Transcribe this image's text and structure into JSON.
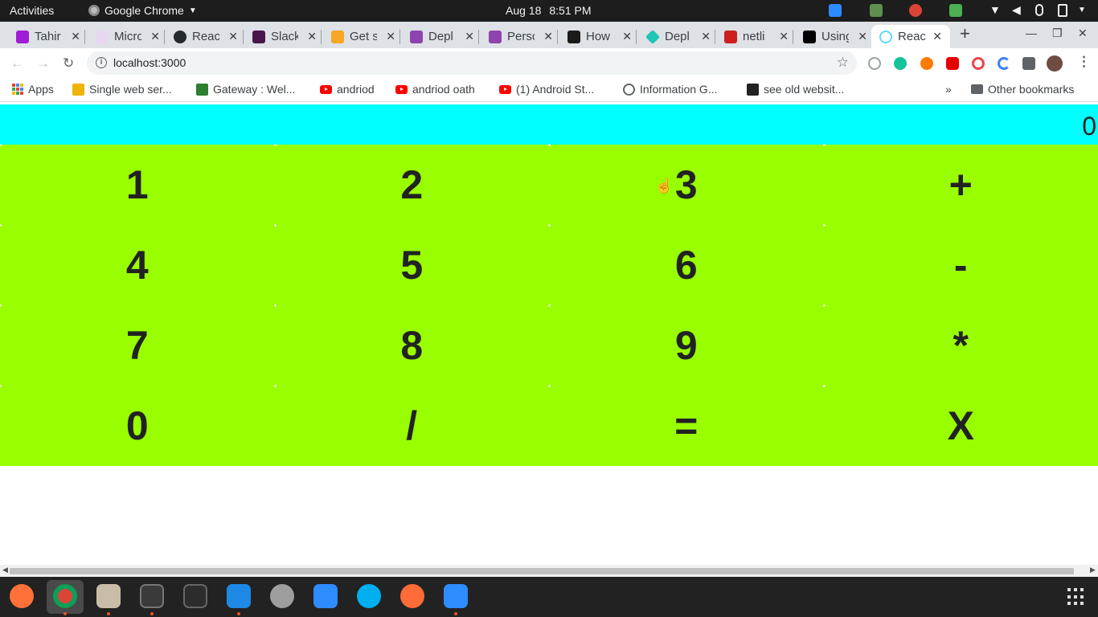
{
  "topbar": {
    "activities": "Activities",
    "app_name": "Google Chrome",
    "date": "Aug 18",
    "time": "8:51 PM"
  },
  "tabs": [
    {
      "title": "Tahir",
      "favicon_color": "#a01cd6"
    },
    {
      "title": "Micro",
      "favicon_color": "#e8d7f0"
    },
    {
      "title": "React",
      "favicon_color": "#24292e"
    },
    {
      "title": "Slack",
      "favicon_color": "#4a154b"
    },
    {
      "title": "Get s",
      "favicon_color": "#f5a623"
    },
    {
      "title": "Depl",
      "favicon_color": "#8e44ad"
    },
    {
      "title": "Perso",
      "favicon_color": "#8e44ad"
    },
    {
      "title": "How",
      "favicon_color": "#1a1a1a"
    },
    {
      "title": "Depl",
      "favicon_color": "#20c6b6"
    },
    {
      "title": "netli",
      "favicon_color": "#cc1f1f"
    },
    {
      "title": "Using",
      "favicon_color": "#000000"
    },
    {
      "title": "Reac",
      "favicon_color": "#61dafb",
      "active": true
    }
  ],
  "toolbar": {
    "url": "localhost:3000"
  },
  "bookmarks": {
    "apps_label": "Apps",
    "items": [
      {
        "label": "Single web ser...",
        "icon": "bulb-icon"
      },
      {
        "label": "Gateway : Wel...",
        "icon": "gateway-icon"
      },
      {
        "label": "andriod",
        "icon": "youtube-icon"
      },
      {
        "label": "andriod oath",
        "icon": "youtube-icon"
      },
      {
        "label": "(1) Android St...",
        "icon": "youtube-icon"
      },
      {
        "label": "Information G...",
        "icon": "globe-icon"
      },
      {
        "label": "see old websit...",
        "icon": "archive-icon"
      }
    ],
    "overflow": "»",
    "other_bookmarks": "Other bookmarks"
  },
  "calculator": {
    "display": "0",
    "keys": [
      "1",
      "2",
      "3",
      "+",
      "4",
      "5",
      "6",
      "-",
      "7",
      "8",
      "9",
      "*",
      "0",
      "/",
      "=",
      "X"
    ],
    "display_color": "#00ffff",
    "keypad_color": "#99ff00"
  },
  "dock": {
    "apps": [
      "firefox-icon",
      "chrome-icon",
      "files-icon",
      "system-monitor-icon",
      "terminal-icon",
      "vscode-icon",
      "settings-icon",
      "zoom-icon",
      "skype-icon",
      "postman-icon",
      "zoom-meeting-icon"
    ]
  }
}
